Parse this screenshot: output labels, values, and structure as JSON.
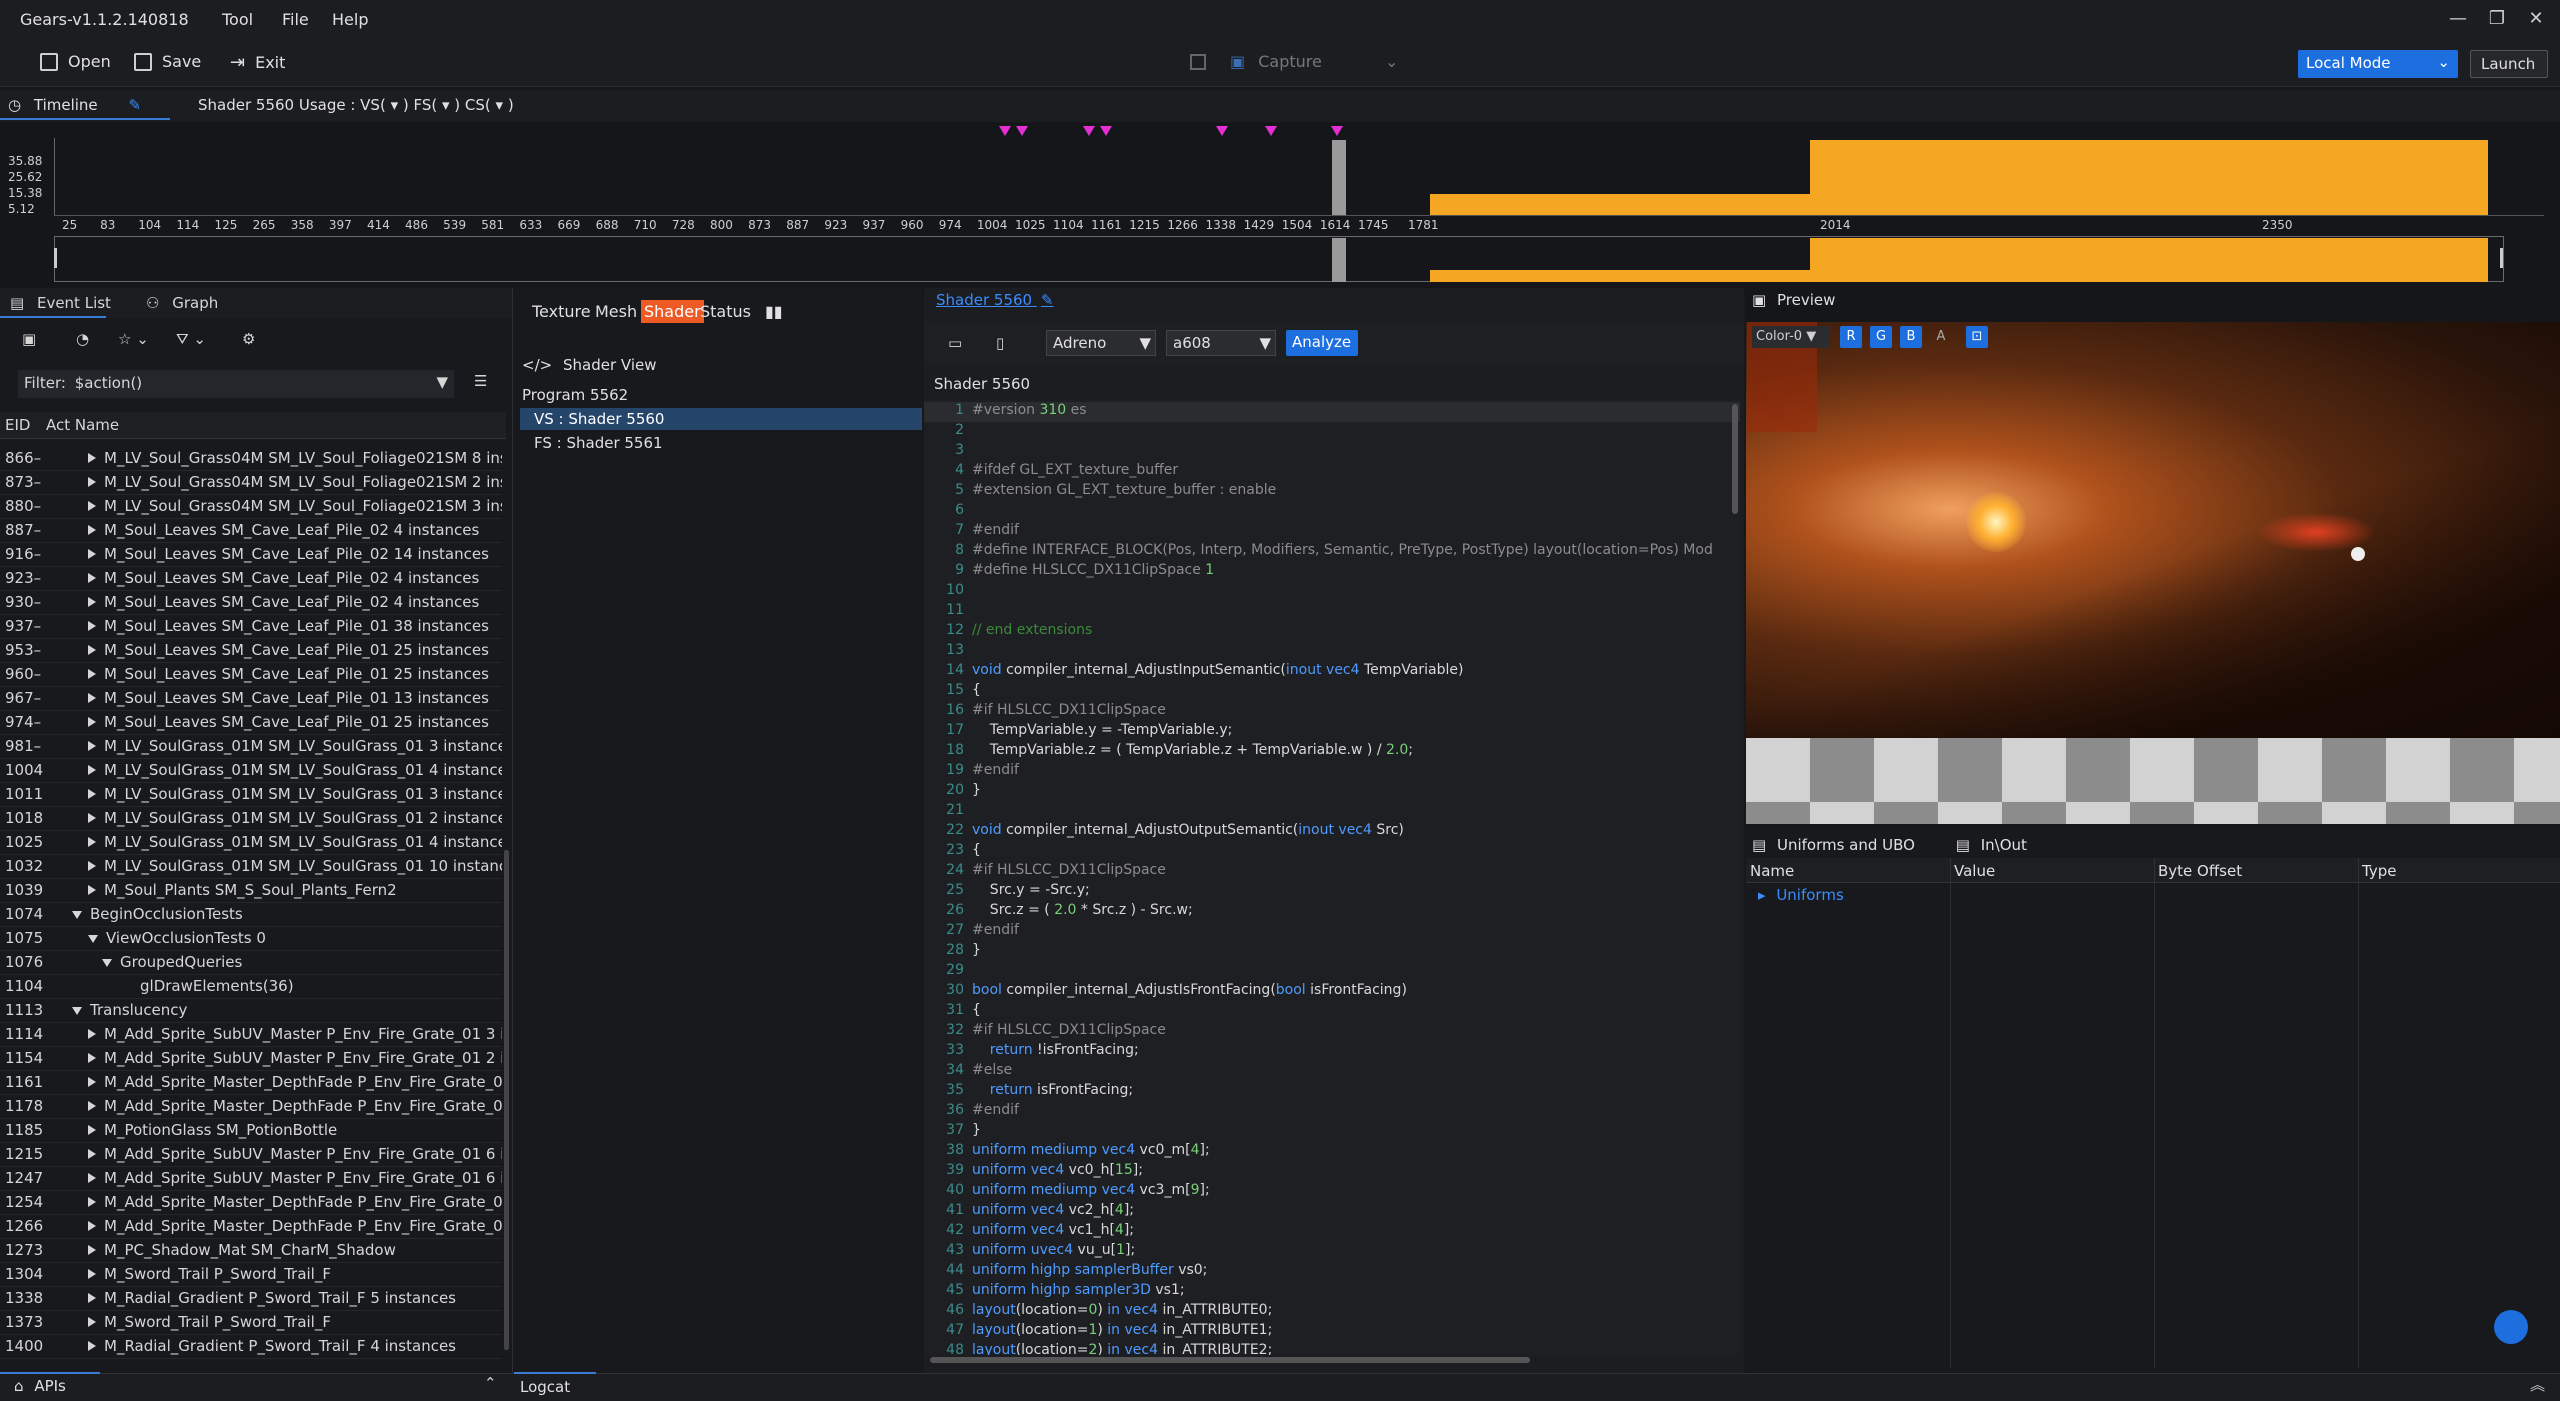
{
  "app": {
    "title": "Gears-v1.1.2.140818",
    "menu": [
      "Tool",
      "File",
      "Help"
    ]
  },
  "toolbar": {
    "open": "Open",
    "save": "Save",
    "exit": "Exit",
    "capture": "Capture",
    "mode": "Local Mode",
    "launch": "Launch"
  },
  "timeline": {
    "tab": "Timeline",
    "shader_usage": "Shader 5560  Usage :  VS(  ▾  )   FS(  ▾  )   CS(  ▾  )",
    "y_ticks": [
      "35.88",
      "25.62",
      "15.38",
      "5.12"
    ],
    "x_ticks": [
      "25",
      "83",
      "104",
      "114",
      "125",
      "265",
      "358",
      "397",
      "414",
      "486",
      "539",
      "581",
      "633",
      "669",
      "688",
      "710",
      "728",
      "800",
      "873",
      "887",
      "923",
      "937",
      "960",
      "974",
      "1004",
      "1025",
      "1104",
      "1161",
      "1215",
      "1266",
      "1338",
      "1429",
      "1504",
      "1614",
      "1745",
      "1781",
      "2014",
      "2350"
    ]
  },
  "chart_data": {
    "type": "bar",
    "title": "",
    "xlabel": "",
    "ylabel": "",
    "y_ticks": [
      5.12,
      15.38,
      25.62,
      35.88
    ],
    "bars": [
      {
        "x_start": 1614,
        "x_end": 1745,
        "value": 35.88,
        "highlight": true
      },
      {
        "x_start": 1781,
        "x_end": 2014,
        "value": 10
      },
      {
        "x_start": 2014,
        "x_end": 2350,
        "value": 35.88
      }
    ],
    "markers_at": [
      1161,
      1175,
      1266,
      1280,
      1429,
      1504,
      1614
    ]
  },
  "event_list": {
    "tabs": [
      "Event List",
      "Graph"
    ],
    "filter_label": "Filter:",
    "filter_value": "$action()",
    "columns": [
      "EID",
      "Act Name"
    ],
    "rows": [
      {
        "eid": "866–",
        "name": "M_LV_Soul_Grass04M SM_LV_Soul_Foliage021SM 8 ins",
        "level": 1,
        "exp": "c"
      },
      {
        "eid": "873–",
        "name": "M_LV_Soul_Grass04M SM_LV_Soul_Foliage021SM 2 ins",
        "level": 1,
        "exp": "c"
      },
      {
        "eid": "880–",
        "name": "M_LV_Soul_Grass04M SM_LV_Soul_Foliage021SM 3 ins",
        "level": 1,
        "exp": "c"
      },
      {
        "eid": "887–",
        "name": "M_Soul_Leaves SM_Cave_Leaf_Pile_02 4 instances",
        "level": 1,
        "exp": "c"
      },
      {
        "eid": "916–",
        "name": "M_Soul_Leaves SM_Cave_Leaf_Pile_02 14 instances",
        "level": 1,
        "exp": "c"
      },
      {
        "eid": "923–",
        "name": "M_Soul_Leaves SM_Cave_Leaf_Pile_02 4 instances",
        "level": 1,
        "exp": "c"
      },
      {
        "eid": "930–",
        "name": "M_Soul_Leaves SM_Cave_Leaf_Pile_02 4 instances",
        "level": 1,
        "exp": "c"
      },
      {
        "eid": "937–",
        "name": "M_Soul_Leaves SM_Cave_Leaf_Pile_01 38 instances",
        "level": 1,
        "exp": "c"
      },
      {
        "eid": "953–",
        "name": "M_Soul_Leaves SM_Cave_Leaf_Pile_01 25 instances",
        "level": 1,
        "exp": "c"
      },
      {
        "eid": "960–",
        "name": "M_Soul_Leaves SM_Cave_Leaf_Pile_01 25 instances",
        "level": 1,
        "exp": "c"
      },
      {
        "eid": "967–",
        "name": "M_Soul_Leaves SM_Cave_Leaf_Pile_01 13 instances",
        "level": 1,
        "exp": "c"
      },
      {
        "eid": "974–",
        "name": "M_Soul_Leaves SM_Cave_Leaf_Pile_01 25 instances",
        "level": 1,
        "exp": "c"
      },
      {
        "eid": "981–",
        "name": "M_LV_SoulGrass_01M SM_LV_SoulGrass_01 3 instance",
        "level": 1,
        "exp": "c"
      },
      {
        "eid": "1004",
        "name": "M_LV_SoulGrass_01M SM_LV_SoulGrass_01 4 instance",
        "level": 1,
        "exp": "c"
      },
      {
        "eid": "1011",
        "name": "M_LV_SoulGrass_01M SM_LV_SoulGrass_01 3 instance",
        "level": 1,
        "exp": "c"
      },
      {
        "eid": "1018",
        "name": "M_LV_SoulGrass_01M SM_LV_SoulGrass_01 2 instance",
        "level": 1,
        "exp": "c"
      },
      {
        "eid": "1025",
        "name": "M_LV_SoulGrass_01M SM_LV_SoulGrass_01 4 instance",
        "level": 1,
        "exp": "c"
      },
      {
        "eid": "1032",
        "name": "M_LV_SoulGrass_01M SM_LV_SoulGrass_01 10 instanc",
        "level": 1,
        "exp": "c"
      },
      {
        "eid": "1039",
        "name": "M_Soul_Plants SM_S_Soul_Plants_Fern2",
        "level": 1,
        "exp": "c"
      },
      {
        "eid": "1074",
        "name": "BeginOcclusionTests",
        "level": 0,
        "exp": "o"
      },
      {
        "eid": "1075",
        "name": "ViewOcclusionTests 0",
        "level": 1,
        "exp": "o"
      },
      {
        "eid": "1076",
        "name": "GroupedQueries",
        "level": 2,
        "exp": "o"
      },
      {
        "eid": "1104",
        "name": "glDrawElements(36)",
        "level": 3,
        "exp": ""
      },
      {
        "eid": "1113",
        "name": "Translucency",
        "level": 0,
        "exp": "o"
      },
      {
        "eid": "1114",
        "name": "M_Add_Sprite_SubUV_Master P_Env_Fire_Grate_01 3 ir",
        "level": 1,
        "exp": "c"
      },
      {
        "eid": "1154",
        "name": "M_Add_Sprite_SubUV_Master P_Env_Fire_Grate_01 2 ir",
        "level": 1,
        "exp": "c"
      },
      {
        "eid": "1161",
        "name": "M_Add_Sprite_Master_DepthFade P_Env_Fire_Grate_01",
        "level": 1,
        "exp": "c"
      },
      {
        "eid": "1178",
        "name": "M_Add_Sprite_Master_DepthFade P_Env_Fire_Grate_01",
        "level": 1,
        "exp": "c"
      },
      {
        "eid": "1185",
        "name": "M_PotionGlass SM_PotionBottle",
        "level": 1,
        "exp": "c"
      },
      {
        "eid": "1215",
        "name": "M_Add_Sprite_SubUV_Master P_Env_Fire_Grate_01 6 ir",
        "level": 1,
        "exp": "c"
      },
      {
        "eid": "1247",
        "name": "M_Add_Sprite_SubUV_Master P_Env_Fire_Grate_01 6 ir",
        "level": 1,
        "exp": "c"
      },
      {
        "eid": "1254",
        "name": "M_Add_Sprite_Master_DepthFade P_Env_Fire_Grate_01",
        "level": 1,
        "exp": "c"
      },
      {
        "eid": "1266",
        "name": "M_Add_Sprite_Master_DepthFade P_Env_Fire_Grate_01",
        "level": 1,
        "exp": "c"
      },
      {
        "eid": "1273",
        "name": "M_PC_Shadow_Mat SM_CharM_Shadow",
        "level": 1,
        "exp": "c"
      },
      {
        "eid": "1304",
        "name": "M_Sword_Trail P_Sword_Trail_F",
        "level": 1,
        "exp": "c"
      },
      {
        "eid": "1338",
        "name": "M_Radial_Gradient P_Sword_Trail_F 5 instances",
        "level": 1,
        "exp": "c"
      },
      {
        "eid": "1373",
        "name": "M_Sword_Trail P_Sword_Trail_F",
        "level": 1,
        "exp": "c"
      },
      {
        "eid": "1400",
        "name": "M_Radial_Gradient P_Sword_Trail_F 4 instances",
        "level": 1,
        "exp": "c"
      }
    ]
  },
  "middle": {
    "tabs": [
      "Texture",
      "Mesh",
      "Shader",
      "Status"
    ],
    "shader_view": "Shader View",
    "program": "Program 5562",
    "vs": "VS : Shader 5560",
    "fs": "FS : Shader 5561"
  },
  "code": {
    "link": "Shader 5560",
    "gpu": "Adreno",
    "model": "a608",
    "analyze": "Analyze",
    "title": "Shader 5560",
    "lines": [
      [
        {
          "c": "pp",
          "t": "#version "
        },
        {
          "c": "nu",
          "t": "310"
        },
        {
          "c": "pp",
          "t": " es"
        }
      ],
      [],
      [],
      [
        {
          "c": "pp",
          "t": "#ifdef GL_EXT_texture_buffer"
        }
      ],
      [
        {
          "c": "pp",
          "t": "#extension GL_EXT_texture_buffer : enable"
        }
      ],
      [],
      [
        {
          "c": "pp",
          "t": "#endif"
        }
      ],
      [
        {
          "c": "pp",
          "t": "#define INTERFACE_BLOCK(Pos, Interp, Modifiers, Semantic, PreType, PostType) layout(location=Pos) Mod"
        }
      ],
      [
        {
          "c": "pp",
          "t": "#define HLSLCC_DX11ClipSpace "
        },
        {
          "c": "nu",
          "t": "1"
        }
      ],
      [],
      [],
      [
        {
          "c": "cm",
          "t": "// end extensions"
        }
      ],
      [],
      [
        {
          "c": "kw",
          "t": "void"
        },
        {
          "c": "fn",
          "t": " compiler_internal_AdjustInputSemantic("
        },
        {
          "c": "kw",
          "t": "inout vec4"
        },
        {
          "c": "fn",
          "t": " TempVariable)"
        }
      ],
      [
        {
          "c": "fn",
          "t": "{"
        }
      ],
      [
        {
          "c": "pp",
          "t": "#if HLSLCC_DX11ClipSpace"
        }
      ],
      [
        {
          "c": "fn",
          "t": "    TempVariable.y = -TempVariable.y;"
        }
      ],
      [
        {
          "c": "fn",
          "t": "    TempVariable.z = ( TempVariable.z + TempVariable.w ) / "
        },
        {
          "c": "nu",
          "t": "2.0"
        },
        {
          "c": "fn",
          "t": ";"
        }
      ],
      [
        {
          "c": "pp",
          "t": "#endif"
        }
      ],
      [
        {
          "c": "fn",
          "t": "}"
        }
      ],
      [],
      [
        {
          "c": "kw",
          "t": "void"
        },
        {
          "c": "fn",
          "t": " compiler_internal_AdjustOutputSemantic("
        },
        {
          "c": "kw",
          "t": "inout vec4"
        },
        {
          "c": "fn",
          "t": " Src)"
        }
      ],
      [
        {
          "c": "fn",
          "t": "{"
        }
      ],
      [
        {
          "c": "pp",
          "t": "#if HLSLCC_DX11ClipSpace"
        }
      ],
      [
        {
          "c": "fn",
          "t": "    Src.y = -Src.y;"
        }
      ],
      [
        {
          "c": "fn",
          "t": "    Src.z = ( "
        },
        {
          "c": "nu",
          "t": "2.0"
        },
        {
          "c": "fn",
          "t": " * Src.z ) - Src.w;"
        }
      ],
      [
        {
          "c": "pp",
          "t": "#endif"
        }
      ],
      [
        {
          "c": "fn",
          "t": "}"
        }
      ],
      [],
      [
        {
          "c": "kw",
          "t": "bool"
        },
        {
          "c": "fn",
          "t": " compiler_internal_AdjustIsFrontFacing("
        },
        {
          "c": "kw",
          "t": "bool"
        },
        {
          "c": "fn",
          "t": " isFrontFacing)"
        }
      ],
      [
        {
          "c": "fn",
          "t": "{"
        }
      ],
      [
        {
          "c": "pp",
          "t": "#if HLSLCC_DX11ClipSpace"
        }
      ],
      [
        {
          "c": "kw",
          "t": "    return"
        },
        {
          "c": "fn",
          "t": " !isFrontFacing;"
        }
      ],
      [
        {
          "c": "pp",
          "t": "#else"
        }
      ],
      [
        {
          "c": "kw",
          "t": "    return"
        },
        {
          "c": "fn",
          "t": " isFrontFacing;"
        }
      ],
      [
        {
          "c": "pp",
          "t": "#endif"
        }
      ],
      [
        {
          "c": "fn",
          "t": "}"
        }
      ],
      [
        {
          "c": "kw",
          "t": "uniform mediump vec4"
        },
        {
          "c": "fn",
          "t": " vc0_m["
        },
        {
          "c": "nu",
          "t": "4"
        },
        {
          "c": "fn",
          "t": "];"
        }
      ],
      [
        {
          "c": "kw",
          "t": "uniform vec4"
        },
        {
          "c": "fn",
          "t": " vc0_h["
        },
        {
          "c": "nu",
          "t": "15"
        },
        {
          "c": "fn",
          "t": "];"
        }
      ],
      [
        {
          "c": "kw",
          "t": "uniform mediump vec4"
        },
        {
          "c": "fn",
          "t": " vc3_m["
        },
        {
          "c": "nu",
          "t": "9"
        },
        {
          "c": "fn",
          "t": "];"
        }
      ],
      [
        {
          "c": "kw",
          "t": "uniform vec4"
        },
        {
          "c": "fn",
          "t": " vc2_h["
        },
        {
          "c": "nu",
          "t": "4"
        },
        {
          "c": "fn",
          "t": "];"
        }
      ],
      [
        {
          "c": "kw",
          "t": "uniform vec4"
        },
        {
          "c": "fn",
          "t": " vc1_h["
        },
        {
          "c": "nu",
          "t": "4"
        },
        {
          "c": "fn",
          "t": "];"
        }
      ],
      [
        {
          "c": "kw",
          "t": "uniform uvec4"
        },
        {
          "c": "fn",
          "t": " vu_u["
        },
        {
          "c": "nu",
          "t": "1"
        },
        {
          "c": "fn",
          "t": "];"
        }
      ],
      [
        {
          "c": "kw",
          "t": "uniform highp samplerBuffer"
        },
        {
          "c": "fn",
          "t": " vs0;"
        }
      ],
      [
        {
          "c": "kw",
          "t": "uniform highp sampler3D"
        },
        {
          "c": "fn",
          "t": " vs1;"
        }
      ],
      [
        {
          "c": "kw",
          "t": "layout"
        },
        {
          "c": "fn",
          "t": "(location="
        },
        {
          "c": "nu",
          "t": "0"
        },
        {
          "c": "fn",
          "t": ") "
        },
        {
          "c": "kw",
          "t": "in vec4"
        },
        {
          "c": "fn",
          "t": " in_ATTRIBUTE0;"
        }
      ],
      [
        {
          "c": "kw",
          "t": "layout"
        },
        {
          "c": "fn",
          "t": "(location="
        },
        {
          "c": "nu",
          "t": "1"
        },
        {
          "c": "fn",
          "t": ") "
        },
        {
          "c": "kw",
          "t": "in vec4"
        },
        {
          "c": "fn",
          "t": " in_ATTRIBUTE1;"
        }
      ],
      [
        {
          "c": "kw",
          "t": "layout"
        },
        {
          "c": "fn",
          "t": "(location="
        },
        {
          "c": "nu",
          "t": "2"
        },
        {
          "c": "fn",
          "t": ") "
        },
        {
          "c": "kw",
          "t": "in vec4"
        },
        {
          "c": "fn",
          "t": " in_ATTRIBUTE2;"
        }
      ]
    ]
  },
  "preview": {
    "title": "Preview",
    "color": "Color-0",
    "channels": [
      "R",
      "G",
      "B",
      "A"
    ]
  },
  "uniforms": {
    "tabs": [
      "Uniforms and UBO",
      "In\\Out"
    ],
    "columns": [
      "Name",
      "Value",
      "Byte Offset",
      "Type"
    ],
    "root": "Uniforms"
  },
  "bottom": {
    "apis": "APIs",
    "logcat": "Logcat"
  },
  "colors": {
    "accent": "#1d6fe0",
    "bar": "#f5a623",
    "marker": "#e52fd2",
    "shader_tab": "#ee5a24"
  }
}
